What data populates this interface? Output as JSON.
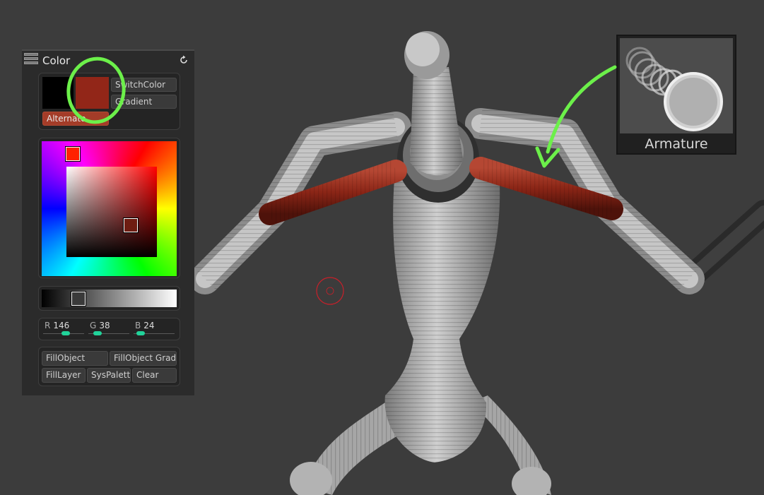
{
  "color_panel": {
    "title": "Color",
    "refresh_icon": "refresh-icon",
    "switch_color_label": "SwitchColor",
    "gradient_label": "Gradient",
    "alternate_label": "Alternate",
    "main_color": "#000000",
    "secondary_color": "#922618",
    "rgb": {
      "r_label": "R",
      "r_value": "146",
      "g_label": "G",
      "g_value": "38",
      "b_label": "B",
      "b_value": "24"
    },
    "buttons": {
      "fill_object": "FillObject",
      "fill_object_grad": "FillObject Grad",
      "fill_layer": "FillLayer",
      "sys_palette": "SysPalette",
      "clear": "Clear"
    }
  },
  "thumbnail": {
    "label": "Armature",
    "icon": "armature-brush-icon"
  },
  "annotations": {
    "highlight_color": "#6cf04a",
    "brush_cursor_color": "#c8202a"
  },
  "model": {
    "body_color": "#b8b8b8",
    "painted_color": "#922618"
  }
}
